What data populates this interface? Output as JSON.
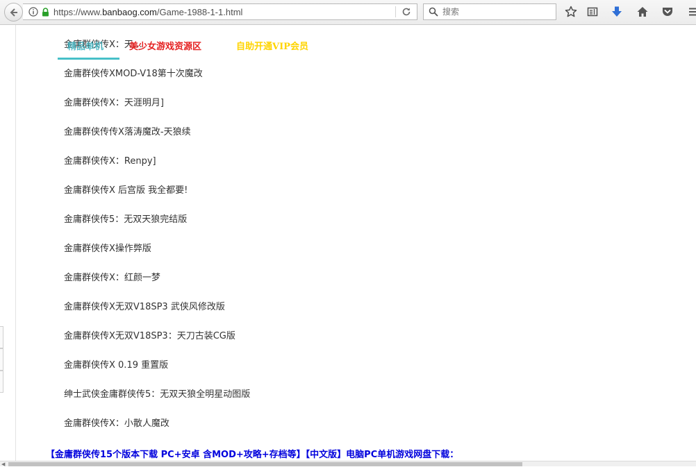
{
  "browser": {
    "url_prefix": "https://www.",
    "url_host": "banbaog.com",
    "url_path": "/Game-1988-1-1.html",
    "search_placeholder": "搜索"
  },
  "icons": {
    "back": "back-arrow-icon",
    "info": "info-icon",
    "lock": "lock-icon",
    "reload": "reload-icon",
    "search": "search-icon",
    "bookmark": "star-icon",
    "reading_list": "reading-list-icon",
    "downloads": "download-arrow-icon",
    "home": "home-icon",
    "pocket": "pocket-icon",
    "menu": "hamburger-menu-icon"
  },
  "colors": {
    "download_accent": "#2f6fd6",
    "nav_active": "#47c0c8",
    "nav_red": "#e52222",
    "nav_yellow": "#ffd400",
    "link_blue": "#0000dd"
  },
  "nav": {
    "active_tab": "精品单机",
    "link_girl": "美少女游戏资源区",
    "link_vip": "自助开通VIP会员"
  },
  "list": [
    "金庸群侠传X：天…",
    "金庸群侠传XMOD-V18第十次魔改",
    "金庸群侠传X：天涯明月]",
    "金庸群侠传传X落涛魔改-天狼续",
    "金庸群侠传X：Renpy]",
    "金庸群侠传X 后宫版 我全都要!",
    "金庸群侠传5：无双天狼完结版",
    "金庸群侠传X操作弊版",
    "金庸群侠传X：红颜一梦",
    "金庸群侠传X无双V18SP3 武侠风修改版",
    "金庸群侠传X无双V18SP3：天刀古装CG版",
    "金庸群侠传X 0.19 重置版",
    "绅士武侠金庸群侠传5：无双天狼全明星动图版",
    "金庸群侠传X：小散人魔改"
  ],
  "bottom_link": "【金庸群侠传15个版本下载 PC+安卓 含MOD+攻略+存档等】【中文版】电脑PC单机游戏网盘下载："
}
